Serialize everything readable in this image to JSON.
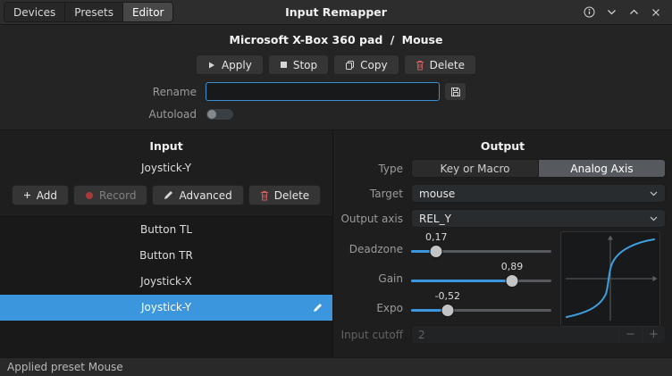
{
  "titlebar": {
    "title": "Input Remapper",
    "tabs": [
      {
        "label": "Devices",
        "active": false
      },
      {
        "label": "Presets",
        "active": false
      },
      {
        "label": "Editor",
        "active": true
      }
    ]
  },
  "header": {
    "device_name": "Microsoft X-Box 360 pad",
    "separator": "/",
    "preset_name": "Mouse",
    "apply_label": "Apply",
    "stop_label": "Stop",
    "copy_label": "Copy",
    "delete_label": "Delete",
    "rename_label": "Rename",
    "rename_value": "",
    "autoload_label": "Autoload",
    "autoload_on": false
  },
  "input_panel": {
    "title": "Input",
    "current": "Joystick-Y",
    "add_label": "Add",
    "record_label": "Record",
    "advanced_label": "Advanced",
    "delete_label": "Delete",
    "items": [
      {
        "label": "Button TL",
        "selected": false
      },
      {
        "label": "Button TR",
        "selected": false
      },
      {
        "label": "Joystick-X",
        "selected": false
      },
      {
        "label": "Joystick-Y",
        "selected": true
      }
    ]
  },
  "output_panel": {
    "title": "Output",
    "type_label": "Type",
    "type_options": [
      {
        "label": "Key or Macro",
        "selected": false
      },
      {
        "label": "Analog Axis",
        "selected": true
      }
    ],
    "target_label": "Target",
    "target_value": "mouse",
    "output_axis_label": "Output axis",
    "output_axis_value": "REL_Y",
    "sliders": [
      {
        "label": "Deadzone",
        "value": "0,17",
        "percent": 18
      },
      {
        "label": "Gain",
        "value": "0,89",
        "percent": 72
      },
      {
        "label": "Expo",
        "value": "-0,52",
        "percent": 26
      }
    ],
    "input_cutoff_label": "Input cutoff",
    "input_cutoff_value": "2",
    "minus_label": "−",
    "plus_label": "+"
  },
  "statusbar": {
    "text": "Applied preset Mouse"
  },
  "colors": {
    "accent": "#3b96dd",
    "danger": "#d35f5f",
    "curve": "#3fa0e0"
  }
}
